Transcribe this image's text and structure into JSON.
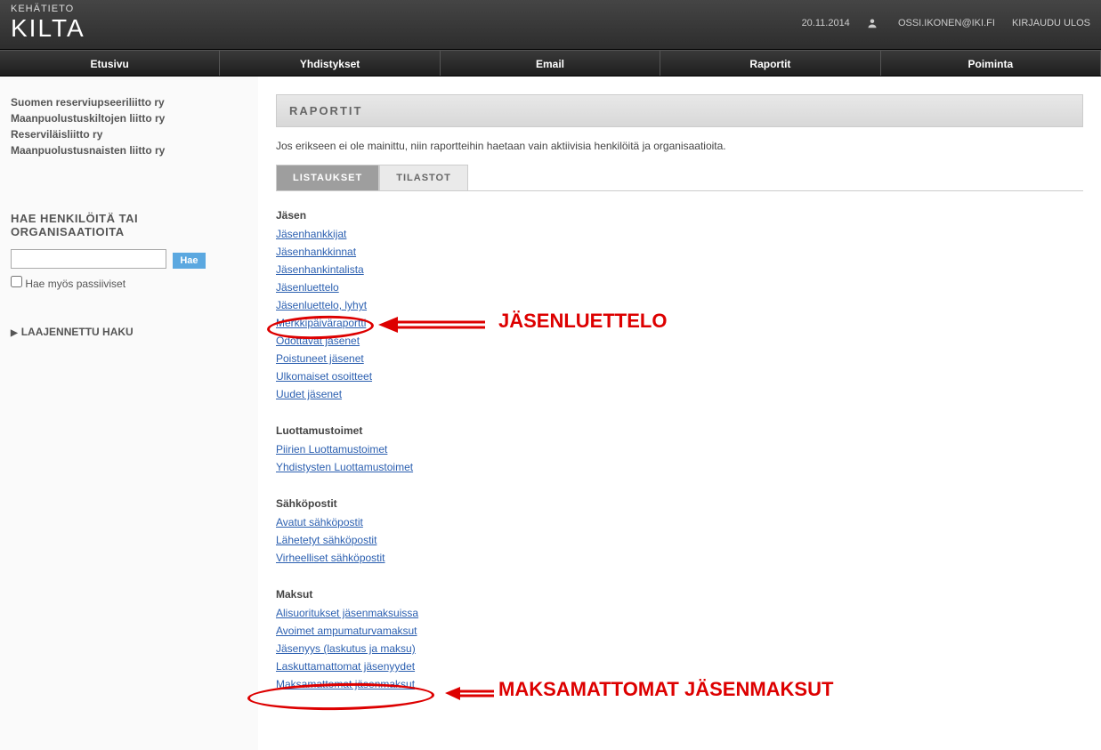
{
  "header": {
    "brand_top": "KEHÄTIETO",
    "brand_main": "KILTA",
    "date": "20.11.2014",
    "user": "OSSI.IKONEN@IKI.FI",
    "logout": "KIRJAUDU ULOS"
  },
  "nav": [
    "Etusivu",
    "Yhdistykset",
    "Email",
    "Raportit",
    "Poiminta"
  ],
  "sidebar": {
    "orgs": [
      "Suomen reserviupseeriliitto ry",
      "Maanpuolustuskiltojen liitto ry",
      "Reserviläisliitto ry",
      "Maanpuolustusnaisten liitto ry"
    ],
    "search_title": "HAE HENKILÖITÄ TAI ORGANISAATIOITA",
    "search_btn": "Hae",
    "search_chk": "Hae myös passiiviset",
    "adv": "LAAJENNETTU HAKU"
  },
  "main": {
    "title": "RAPORTIT",
    "intro": "Jos erikseen ei ole mainittu, niin raportteihin haetaan vain aktiivisia henkilöitä ja organisaatioita.",
    "tabs": {
      "listaukset": "LISTAUKSET",
      "tilastot": "TILASTOT"
    },
    "sections": [
      {
        "title": "Jäsen",
        "links": [
          "Jäsenhankkijat",
          "Jäsenhankkinnat",
          "Jäsenhankintalista",
          "Jäsenluettelo",
          "Jäsenluettelo, lyhyt",
          "Merkkipäiväraportti",
          "Odottavat jäsenet",
          "Poistuneet jäsenet",
          "Ulkomaiset osoitteet",
          "Uudet jäsenet"
        ]
      },
      {
        "title": "Luottamustoimet",
        "links": [
          "Piirien Luottamustoimet",
          "Yhdistysten Luottamustoimet"
        ]
      },
      {
        "title": "Sähköpostit",
        "links": [
          "Avatut sähköpostit",
          "Lähetetyt sähköpostit",
          "Virheelliset sähköpostit"
        ]
      },
      {
        "title": "Maksut",
        "links": [
          "Alisuoritukset jäsenmaksuissa",
          "Avoimet ampumaturvamaksut",
          "Jäsenyys (laskutus ja maksu)",
          "Laskuttamattomat jäsenyydet",
          "Maksamattomat jäsenmaksut"
        ]
      }
    ]
  },
  "annotations": {
    "callout1": "JÄSENLUETTELO",
    "callout2": "MAKSAMATTOMAT JÄSENMAKSUT"
  }
}
